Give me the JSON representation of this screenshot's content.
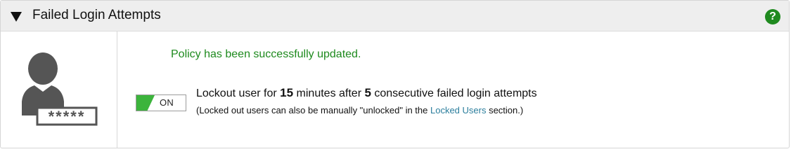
{
  "header": {
    "title": "Failed Login Attempts",
    "collapse_icon": "triangle-down-icon",
    "help_icon": "help-icon",
    "help_symbol": "?",
    "help_color": "#1f8a1f"
  },
  "sidebar": {
    "icon": "user-password-icon",
    "password_mask": "*****"
  },
  "main": {
    "success_message": "Policy has been successfully updated.",
    "success_color": "#1e8a1e",
    "toggle": {
      "label": "ON",
      "state": "on",
      "accent_color": "#3cb43c"
    },
    "setting": {
      "prefix": "Lockout user for ",
      "minutes": "15",
      "middle": " minutes after ",
      "attempts": "5",
      "suffix": " consecutive failed login attempts"
    },
    "note": {
      "prefix": "(Locked out users can also be manually \"unlocked\" in the ",
      "link_text": "Locked Users",
      "suffix": " section.)",
      "link_color": "#2a7d9c"
    }
  }
}
